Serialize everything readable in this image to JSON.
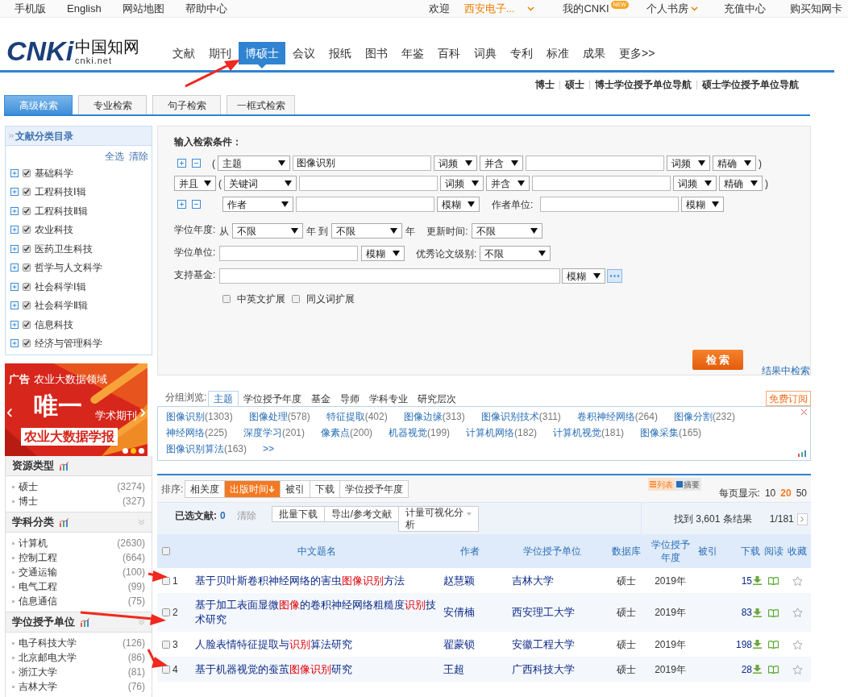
{
  "top_bar": {
    "links": [
      "手机版",
      "English",
      "网站地图",
      "帮助中心"
    ],
    "welcome": "欢迎",
    "user": "西安电子...",
    "my_cnki": "我的CNKI",
    "new_badge": "NEW",
    "library": "个人书房",
    "recharge": "充值中心",
    "buy_card": "购买知网卡"
  },
  "logo": {
    "mark": "CNKi",
    "name": "中国知网",
    "domain": "cnki.net"
  },
  "nav": [
    {
      "label": "文献",
      "selected": false
    },
    {
      "label": "期刊",
      "selected": false
    },
    {
      "label": "博硕士",
      "selected": true
    },
    {
      "label": "会议",
      "selected": false
    },
    {
      "label": "报纸",
      "selected": false
    },
    {
      "label": "图书",
      "selected": false
    },
    {
      "label": "年鉴",
      "selected": false
    },
    {
      "label": "百科",
      "selected": false
    },
    {
      "label": "词典",
      "selected": false
    },
    {
      "label": "专利",
      "selected": false
    },
    {
      "label": "标准",
      "selected": false
    },
    {
      "label": "成果",
      "selected": false
    },
    {
      "label": "更多>>",
      "selected": false
    }
  ],
  "sub_links": [
    "博士",
    "硕士",
    "博士学位授予单位导航",
    "硕士学位授予单位导航"
  ],
  "search_tabs": [
    {
      "label": "高级检索",
      "selected": true
    },
    {
      "label": "专业检索",
      "selected": false
    },
    {
      "label": "句子检索",
      "selected": false
    },
    {
      "label": "一框式检索",
      "selected": false
    }
  ],
  "catalog": {
    "title": "文献分类目录",
    "select_all": "全选",
    "clear": "清除",
    "categories": [
      {
        "label": "基础科学",
        "checked": true
      },
      {
        "label": "工程科技Ⅰ辑",
        "checked": true
      },
      {
        "label": "工程科技Ⅱ辑",
        "checked": true
      },
      {
        "label": "农业科技",
        "checked": true
      },
      {
        "label": "医药卫生科技",
        "checked": true
      },
      {
        "label": "哲学与人文科学",
        "checked": true
      },
      {
        "label": "社会科学Ⅰ辑",
        "checked": true
      },
      {
        "label": "社会科学Ⅱ辑",
        "checked": true
      },
      {
        "label": "信息科技",
        "checked": true
      },
      {
        "label": "经济与管理科学",
        "checked": true
      }
    ]
  },
  "ad": {
    "tag": "广告",
    "line1": "农业大数据领域",
    "big": "唯一",
    "small": "学术期刊",
    "journal": "农业大数据学报",
    "prev": "‹",
    "next": "›"
  },
  "facets": [
    {
      "title": "资源类型",
      "collapsible": false,
      "items": [
        {
          "label": "硕士",
          "count": "(3274)"
        },
        {
          "label": "博士",
          "count": "(327)"
        }
      ]
    },
    {
      "title": "学科分类",
      "collapsible": true,
      "items": [
        {
          "label": "计算机",
          "count": "(2630)"
        },
        {
          "label": "控制工程",
          "count": "(664)"
        },
        {
          "label": "交通运输",
          "count": "(100)"
        },
        {
          "label": "电气工程",
          "count": "(99)"
        },
        {
          "label": "信息通信",
          "count": "(75)"
        }
      ]
    },
    {
      "title": "学位授予单位",
      "collapsible": true,
      "items": [
        {
          "label": "电子科技大学",
          "count": "(126)"
        },
        {
          "label": "北京邮电大学",
          "count": "(86)"
        },
        {
          "label": "浙江大学",
          "count": "(81)"
        },
        {
          "label": "吉林大学",
          "count": "(76)"
        }
      ]
    }
  ],
  "form": {
    "heading": "输入检索条件：",
    "open": "(",
    "close": ")",
    "row1": {
      "field": "主题",
      "value": "图像识别",
      "freq1": "词频",
      "logic": "并含",
      "freq2": "词频",
      "match": "精确"
    },
    "row2": {
      "op": "并且",
      "field": "关键词",
      "freq1": "词频",
      "logic": "并含",
      "freq2": "词频",
      "match": "精确"
    },
    "row3": {
      "field": "作者",
      "match": "模糊",
      "unit_label": "作者单位:",
      "unit_match": "模糊"
    },
    "year": {
      "label": "学位年度:",
      "from": "从",
      "from_value": "不限",
      "to": "年 到",
      "to_value": "不限",
      "suffix": "年",
      "update_label": "更新时间:",
      "update_value": "不限"
    },
    "unit": {
      "label": "学位单位:",
      "match": "模糊",
      "level_label": "优秀论文级别:",
      "level_value": "不限"
    },
    "fund": {
      "label": "支持基金:",
      "match": "模糊"
    },
    "expand": [
      {
        "label": "中英文扩展",
        "checked": false
      },
      {
        "label": "同义词扩展",
        "checked": false
      }
    ],
    "search_button": "检 索",
    "in_results": "结果中检索"
  },
  "group": {
    "label": "分组浏览:",
    "tabs": [
      {
        "label": "主题",
        "selected": true
      },
      {
        "label": "学位授予年度",
        "selected": false
      },
      {
        "label": "基金",
        "selected": false
      },
      {
        "label": "导师",
        "selected": false
      },
      {
        "label": "学科专业",
        "selected": false
      },
      {
        "label": "研究层次",
        "selected": false
      }
    ],
    "subscribe": "免费订阅",
    "more": ">>",
    "items": [
      {
        "label": "图像识别",
        "count": "(1303)"
      },
      {
        "label": "图像处理",
        "count": "(578)"
      },
      {
        "label": "特征提取",
        "count": "(402)"
      },
      {
        "label": "图像边缘",
        "count": "(313)"
      },
      {
        "label": "图像识别技术",
        "count": "(311)"
      },
      {
        "label": "卷积神经网络",
        "count": "(264)"
      },
      {
        "label": "图像分割",
        "count": "(232)"
      },
      {
        "label": "神经网络",
        "count": "(225)"
      },
      {
        "label": "深度学习",
        "count": "(201)"
      },
      {
        "label": "像素点",
        "count": "(200)"
      },
      {
        "label": "机器视觉",
        "count": "(199)"
      },
      {
        "label": "计算机网络",
        "count": "(182)"
      },
      {
        "label": "计算机视觉",
        "count": "(181)"
      },
      {
        "label": "图像采集",
        "count": "(165)"
      },
      {
        "label": "图像识别算法",
        "count": "(163)"
      }
    ]
  },
  "sort": {
    "label": "排序:",
    "options": [
      {
        "label": "相关度",
        "selected": false
      },
      {
        "label": "出版时间",
        "selected": true
      },
      {
        "label": "被引",
        "selected": false
      },
      {
        "label": "下载",
        "selected": false
      },
      {
        "label": "学位授予年度",
        "selected": false
      }
    ],
    "views": [
      {
        "label": "列表",
        "selected": true
      },
      {
        "label": "摘要",
        "selected": false
      }
    ],
    "per_page_label": "每页显示:",
    "per_page": [
      {
        "label": "10",
        "selected": false
      },
      {
        "label": "20",
        "selected": true
      },
      {
        "label": "50",
        "selected": false
      }
    ]
  },
  "selection": {
    "label": "已选文献:",
    "count": "0",
    "clear": "清除",
    "buttons": [
      "批量下载",
      "导出/参考文献"
    ],
    "analysis": "计量可视化分析",
    "found": "找到 3,601 条结果",
    "page": "1/181"
  },
  "table": {
    "columns": [
      "中文题名",
      "作者",
      "学位授予单位",
      "数据库",
      "学位授予年度",
      "被引",
      "下载",
      "阅读",
      "收藏"
    ],
    "rows": [
      {
        "number": "1",
        "checked": false,
        "title": [
          {
            "text": "基于贝叶斯卷积神经网络的害虫",
            "highlight": false
          },
          {
            "text": "图像识别",
            "highlight": true
          },
          {
            "text": "方法",
            "highlight": false
          }
        ],
        "author": "赵慧颖",
        "unit": "吉林大学",
        "db": "硕士",
        "year": "2019年",
        "downloads": "15"
      },
      {
        "number": "2",
        "checked": false,
        "title": [
          {
            "text": "基于加工表面显微",
            "highlight": false
          },
          {
            "text": "图像",
            "highlight": true
          },
          {
            "text": "的卷积神经网络粗糙度",
            "highlight": false
          },
          {
            "text": "识别",
            "highlight": true
          },
          {
            "text": "技术研究",
            "highlight": false
          }
        ],
        "author": "安倩楠",
        "unit": "西安理工大学",
        "db": "硕士",
        "year": "2019年",
        "downloads": "83"
      },
      {
        "number": "3",
        "checked": false,
        "title": [
          {
            "text": "人脸表情特征提取与",
            "highlight": false
          },
          {
            "text": "识别",
            "highlight": true
          },
          {
            "text": "算法研究",
            "highlight": false
          }
        ],
        "author": "翟蒙锁",
        "unit": "安徽工程大学",
        "db": "硕士",
        "year": "2019年",
        "downloads": "198"
      },
      {
        "number": "4",
        "checked": false,
        "title": [
          {
            "text": "基于机器视觉的蚕茧",
            "highlight": false
          },
          {
            "text": "图像识别",
            "highlight": true
          },
          {
            "text": "研究",
            "highlight": false
          }
        ],
        "author": "王超",
        "unit": "广西科技大学",
        "db": "硕士",
        "year": "2019年",
        "downloads": "28"
      }
    ],
    "select_all_checked": false
  }
}
